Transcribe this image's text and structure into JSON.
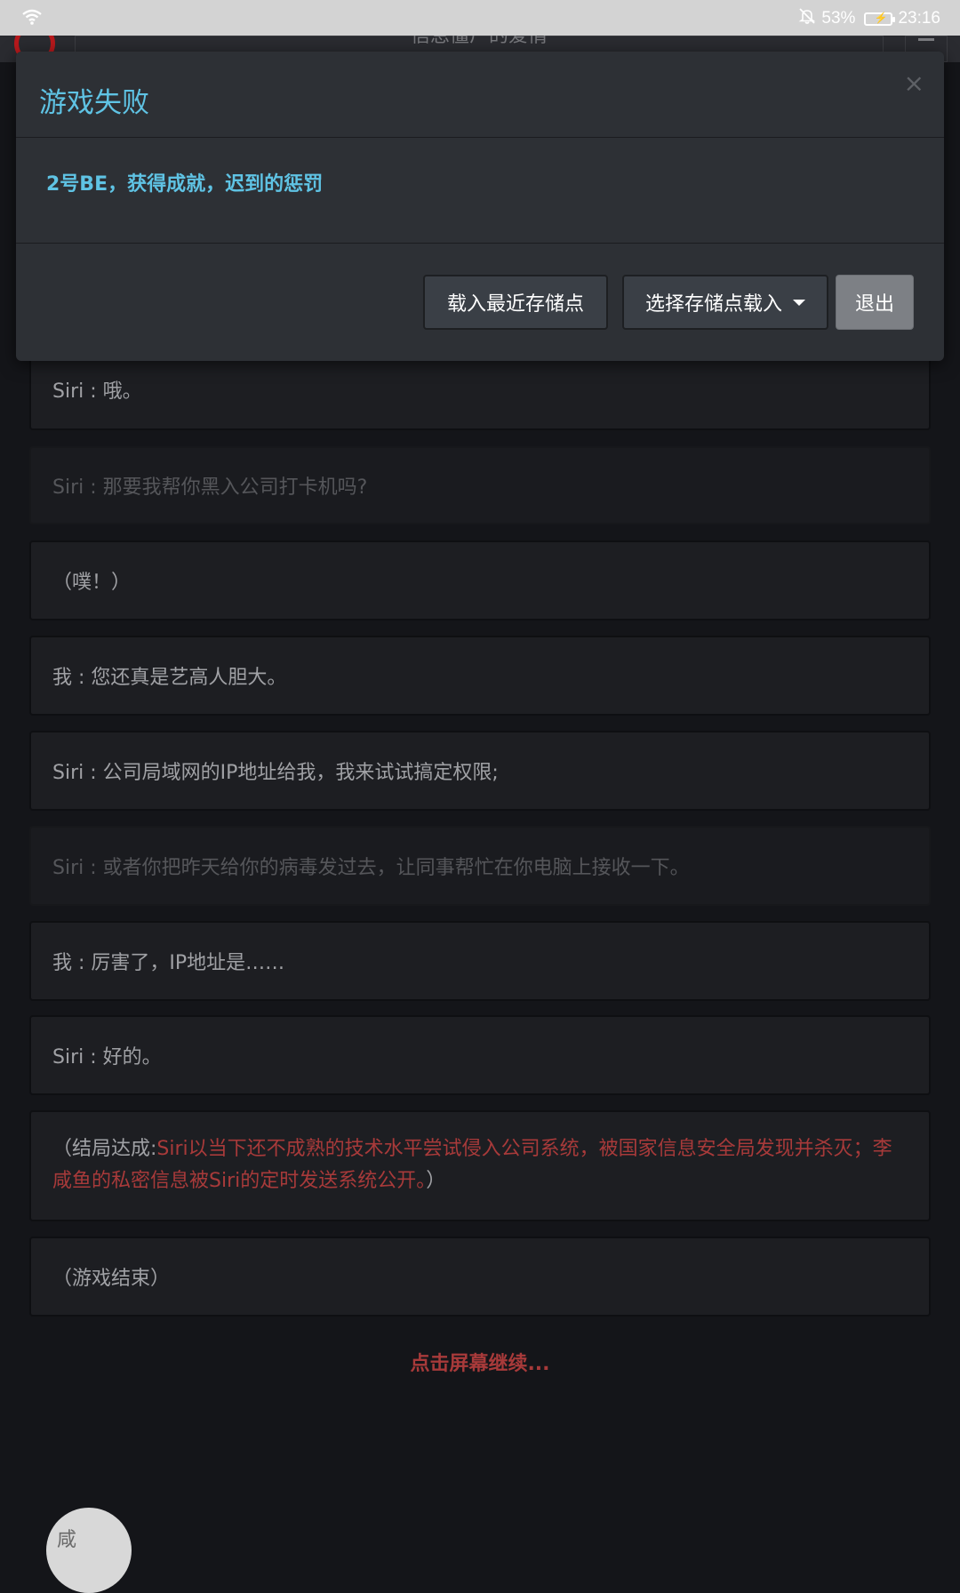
{
  "status_bar": {
    "battery": "53%",
    "time": "23:16"
  },
  "page_header": {
    "title": "信息僵尸的爱情"
  },
  "modal": {
    "title": "游戏失败",
    "close": "×",
    "message": "2号BE，获得成就，迟到的惩罚",
    "buttons": {
      "load_recent": "载入最近存储点",
      "choose_save": "选择存储点载入",
      "exit": "退出"
    }
  },
  "dialogue": [
    "Siri : 哦。",
    "Siri : 那要我帮你黑入公司打卡机吗?",
    "（噗！）",
    "我 : 您还真是艺高人胆大。",
    "Siri : 公司局域网的IP地址给我，我来试试搞定权限;",
    "Siri : 或者你把昨天给你的病毒发过去，让同事帮忙在你电脑上接收一下。",
    "我 : 厉害了，IP地址是……",
    "Siri : 好的。"
  ],
  "ending": {
    "prefix": "（结局达成:",
    "highlight": "Siri以当下还不成熟的技术水平尝试侵入公司系统，被国家信息安全局发现并杀灭；李咸鱼的私密信息被Siri的定时发送系统公开。",
    "suffix": "）"
  },
  "game_over": "（游戏结束）",
  "continue_prompt": "点击屏幕继续...",
  "floating_avatar_text": "咸"
}
